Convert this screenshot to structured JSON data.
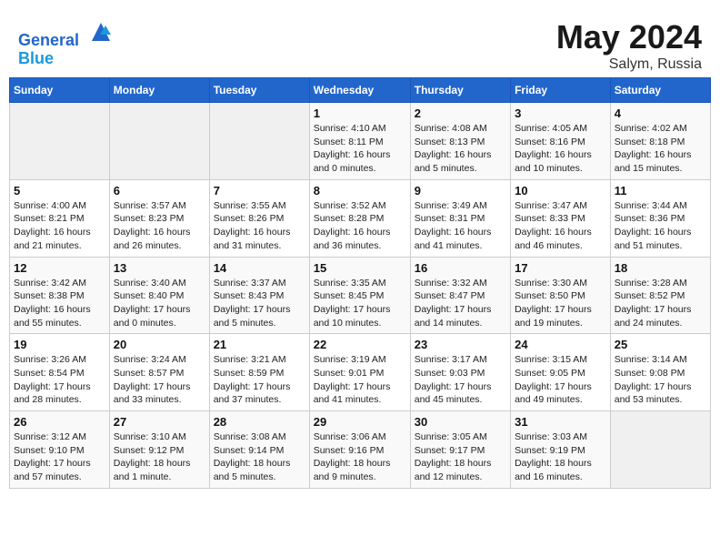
{
  "header": {
    "logo_line1": "General",
    "logo_line2": "Blue",
    "month": "May 2024",
    "location": "Salym, Russia"
  },
  "days_of_week": [
    "Sunday",
    "Monday",
    "Tuesday",
    "Wednesday",
    "Thursday",
    "Friday",
    "Saturday"
  ],
  "weeks": [
    [
      {
        "day": "",
        "info": ""
      },
      {
        "day": "",
        "info": ""
      },
      {
        "day": "",
        "info": ""
      },
      {
        "day": "1",
        "info": "Sunrise: 4:10 AM\nSunset: 8:11 PM\nDaylight: 16 hours\nand 0 minutes."
      },
      {
        "day": "2",
        "info": "Sunrise: 4:08 AM\nSunset: 8:13 PM\nDaylight: 16 hours\nand 5 minutes."
      },
      {
        "day": "3",
        "info": "Sunrise: 4:05 AM\nSunset: 8:16 PM\nDaylight: 16 hours\nand 10 minutes."
      },
      {
        "day": "4",
        "info": "Sunrise: 4:02 AM\nSunset: 8:18 PM\nDaylight: 16 hours\nand 15 minutes."
      }
    ],
    [
      {
        "day": "5",
        "info": "Sunrise: 4:00 AM\nSunset: 8:21 PM\nDaylight: 16 hours\nand 21 minutes."
      },
      {
        "day": "6",
        "info": "Sunrise: 3:57 AM\nSunset: 8:23 PM\nDaylight: 16 hours\nand 26 minutes."
      },
      {
        "day": "7",
        "info": "Sunrise: 3:55 AM\nSunset: 8:26 PM\nDaylight: 16 hours\nand 31 minutes."
      },
      {
        "day": "8",
        "info": "Sunrise: 3:52 AM\nSunset: 8:28 PM\nDaylight: 16 hours\nand 36 minutes."
      },
      {
        "day": "9",
        "info": "Sunrise: 3:49 AM\nSunset: 8:31 PM\nDaylight: 16 hours\nand 41 minutes."
      },
      {
        "day": "10",
        "info": "Sunrise: 3:47 AM\nSunset: 8:33 PM\nDaylight: 16 hours\nand 46 minutes."
      },
      {
        "day": "11",
        "info": "Sunrise: 3:44 AM\nSunset: 8:36 PM\nDaylight: 16 hours\nand 51 minutes."
      }
    ],
    [
      {
        "day": "12",
        "info": "Sunrise: 3:42 AM\nSunset: 8:38 PM\nDaylight: 16 hours\nand 55 minutes."
      },
      {
        "day": "13",
        "info": "Sunrise: 3:40 AM\nSunset: 8:40 PM\nDaylight: 17 hours\nand 0 minutes."
      },
      {
        "day": "14",
        "info": "Sunrise: 3:37 AM\nSunset: 8:43 PM\nDaylight: 17 hours\nand 5 minutes."
      },
      {
        "day": "15",
        "info": "Sunrise: 3:35 AM\nSunset: 8:45 PM\nDaylight: 17 hours\nand 10 minutes."
      },
      {
        "day": "16",
        "info": "Sunrise: 3:32 AM\nSunset: 8:47 PM\nDaylight: 17 hours\nand 14 minutes."
      },
      {
        "day": "17",
        "info": "Sunrise: 3:30 AM\nSunset: 8:50 PM\nDaylight: 17 hours\nand 19 minutes."
      },
      {
        "day": "18",
        "info": "Sunrise: 3:28 AM\nSunset: 8:52 PM\nDaylight: 17 hours\nand 24 minutes."
      }
    ],
    [
      {
        "day": "19",
        "info": "Sunrise: 3:26 AM\nSunset: 8:54 PM\nDaylight: 17 hours\nand 28 minutes."
      },
      {
        "day": "20",
        "info": "Sunrise: 3:24 AM\nSunset: 8:57 PM\nDaylight: 17 hours\nand 33 minutes."
      },
      {
        "day": "21",
        "info": "Sunrise: 3:21 AM\nSunset: 8:59 PM\nDaylight: 17 hours\nand 37 minutes."
      },
      {
        "day": "22",
        "info": "Sunrise: 3:19 AM\nSunset: 9:01 PM\nDaylight: 17 hours\nand 41 minutes."
      },
      {
        "day": "23",
        "info": "Sunrise: 3:17 AM\nSunset: 9:03 PM\nDaylight: 17 hours\nand 45 minutes."
      },
      {
        "day": "24",
        "info": "Sunrise: 3:15 AM\nSunset: 9:05 PM\nDaylight: 17 hours\nand 49 minutes."
      },
      {
        "day": "25",
        "info": "Sunrise: 3:14 AM\nSunset: 9:08 PM\nDaylight: 17 hours\nand 53 minutes."
      }
    ],
    [
      {
        "day": "26",
        "info": "Sunrise: 3:12 AM\nSunset: 9:10 PM\nDaylight: 17 hours\nand 57 minutes."
      },
      {
        "day": "27",
        "info": "Sunrise: 3:10 AM\nSunset: 9:12 PM\nDaylight: 18 hours\nand 1 minute."
      },
      {
        "day": "28",
        "info": "Sunrise: 3:08 AM\nSunset: 9:14 PM\nDaylight: 18 hours\nand 5 minutes."
      },
      {
        "day": "29",
        "info": "Sunrise: 3:06 AM\nSunset: 9:16 PM\nDaylight: 18 hours\nand 9 minutes."
      },
      {
        "day": "30",
        "info": "Sunrise: 3:05 AM\nSunset: 9:17 PM\nDaylight: 18 hours\nand 12 minutes."
      },
      {
        "day": "31",
        "info": "Sunrise: 3:03 AM\nSunset: 9:19 PM\nDaylight: 18 hours\nand 16 minutes."
      },
      {
        "day": "",
        "info": ""
      }
    ]
  ]
}
